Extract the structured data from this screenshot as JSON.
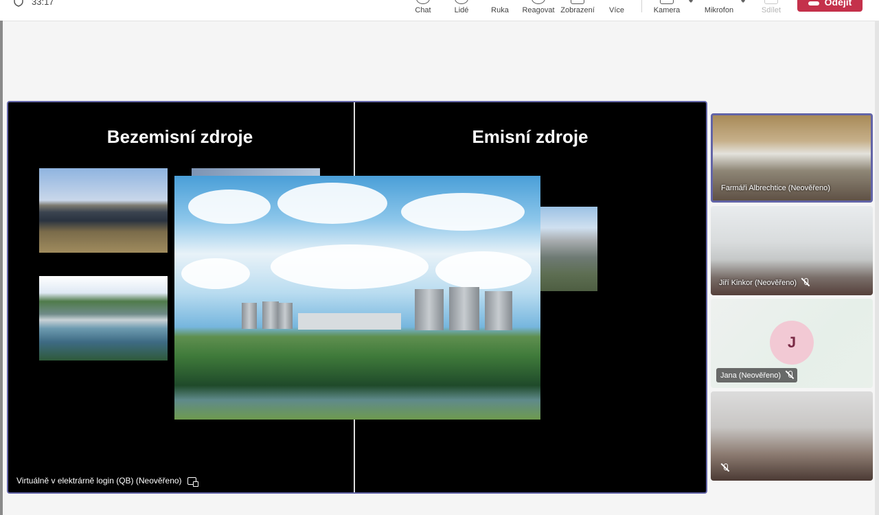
{
  "header": {
    "timer": "33:17",
    "toolbar": [
      {
        "label": "Chat",
        "icon": "chat-icon"
      },
      {
        "label": "Lidé",
        "icon": "people-icon"
      },
      {
        "label": "Ruka",
        "icon": "raise-hand-icon"
      },
      {
        "label": "Reagovat",
        "icon": "react-icon"
      },
      {
        "label": "Zobrazení",
        "icon": "view-icon"
      },
      {
        "label": "Více",
        "icon": "more-icon"
      },
      {
        "label": "Kamera",
        "icon": "camera-icon"
      },
      {
        "label": "Mikrofon",
        "icon": "microphone-icon"
      },
      {
        "label": "Sdílet",
        "icon": "share-icon",
        "disabled": true
      }
    ],
    "leave_label": "Odejít",
    "accent_color": "#6264a7",
    "leave_color": "#c4314b"
  },
  "stage": {
    "slide": {
      "left_heading": "Bezemisní zdroje",
      "right_heading": "Emisní zdroje"
    },
    "presenter_label": "Virtuálně v elektrárně login (QB) (Neověřeno)"
  },
  "participants": [
    {
      "name": "Farmáři Albrechtice (Neověřeno)",
      "muted": false,
      "active": true
    },
    {
      "name": "Jiří Kinkor (Neověřeno)",
      "muted": true
    },
    {
      "name": "Jana (Neověřeno)",
      "muted": true,
      "initial": "J"
    },
    {
      "name": "",
      "muted": true
    }
  ]
}
